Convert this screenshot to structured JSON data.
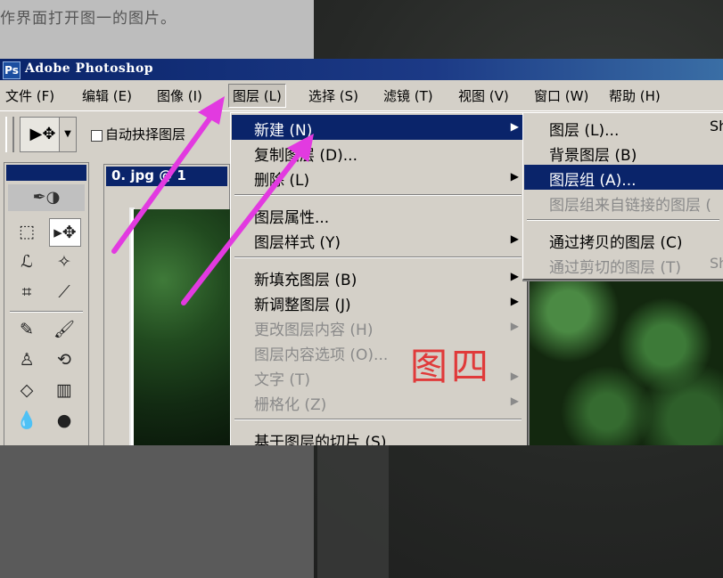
{
  "background": {
    "caption": "作界面打开图一的图片。"
  },
  "window": {
    "title": "Adobe Photoshop",
    "logo_icon": "photoshop-logo-icon"
  },
  "menubar": {
    "items": [
      {
        "label": "文件 (F)"
      },
      {
        "label": "编辑 (E)"
      },
      {
        "label": "图像 (I)"
      },
      {
        "label": "图层 (L)"
      },
      {
        "label": "选择 (S)"
      },
      {
        "label": "滤镜 (T)"
      },
      {
        "label": "视图 (V)"
      },
      {
        "label": "窗口 (W)"
      },
      {
        "label": "帮助 (H)"
      }
    ]
  },
  "options_bar": {
    "auto_select_label": "自动抉择图层",
    "auto_select_checked": false
  },
  "document": {
    "title": "0. jpg @ 1"
  },
  "layer_menu": {
    "items": [
      {
        "label": "新建 (N)",
        "submenu": true,
        "highlighted": true,
        "enabled": true
      },
      {
        "label": "复制图层 (D)...",
        "submenu": false,
        "enabled": true
      },
      {
        "label": "删除 (L)",
        "submenu": true,
        "enabled": true
      },
      {
        "label": "图层属性...",
        "submenu": false,
        "enabled": true
      },
      {
        "label": "图层样式 (Y)",
        "submenu": true,
        "enabled": true
      },
      {
        "label": "新填充图层 (B)",
        "submenu": true,
        "enabled": true
      },
      {
        "label": "新调整图层 (J)",
        "submenu": true,
        "enabled": true
      },
      {
        "label": "更改图层内容 (H)",
        "submenu": true,
        "enabled": false
      },
      {
        "label": "图层内容选项 (O)...",
        "submenu": false,
        "enabled": false
      },
      {
        "label": "文字 (T)",
        "submenu": true,
        "enabled": false
      },
      {
        "label": "栅格化 (Z)",
        "submenu": true,
        "enabled": false
      },
      {
        "label": "基于图层的切片 (S)",
        "submenu": false,
        "enabled": true
      }
    ]
  },
  "new_submenu": {
    "items": [
      {
        "label": "图层 (L)...",
        "shortcut": "Sh",
        "enabled": true
      },
      {
        "label": "背景图层 (B)",
        "shortcut": "",
        "enabled": true
      },
      {
        "label": "图层组 (A)...",
        "shortcut": "",
        "enabled": true,
        "highlighted": true
      },
      {
        "label": "图层组来自链接的图层 (",
        "shortcut": "",
        "enabled": false
      },
      {
        "label": "通过拷贝的图层 (C)",
        "shortcut": "",
        "enabled": true
      },
      {
        "label": "通过剪切的图层 (T)",
        "shortcut": "Sh",
        "enabled": false
      }
    ]
  },
  "annotation": {
    "text": "图四",
    "color": "#e03a3a"
  },
  "arrow_color": "#e23ae0"
}
